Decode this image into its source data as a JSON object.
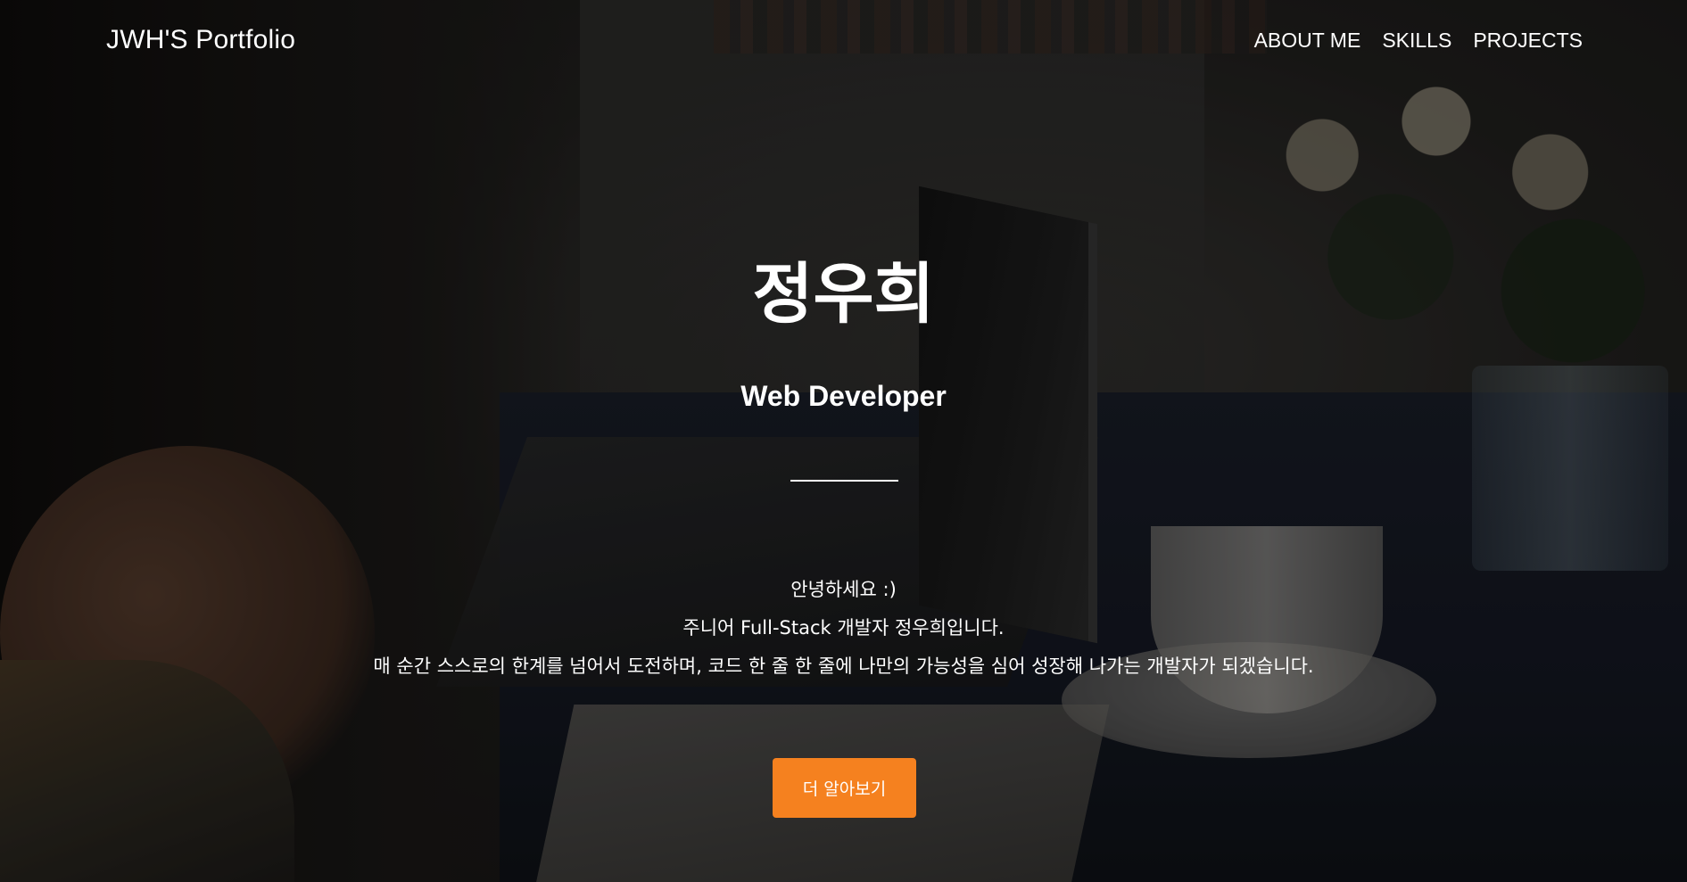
{
  "navbar": {
    "brand": "JWH'S Portfolio",
    "links": [
      "ABOUT ME",
      "SKILLS",
      "PROJECTS"
    ]
  },
  "hero": {
    "name": "정우희",
    "role": "Web Developer",
    "intro_lines": [
      "안녕하세요 :)",
      "주니어 Full-Stack 개발자 정우희입니다.",
      "매 순간 스스로의 한계를 넘어서 도전하며, 코드 한 줄 한 줄에 나만의 가능성을 심어 성장해 나가는 개발자가 되겠습니다."
    ],
    "cta_label": "더 알아보기"
  },
  "colors": {
    "accent": "#f5811f",
    "text": "#ffffff",
    "overlay": "#000000"
  }
}
